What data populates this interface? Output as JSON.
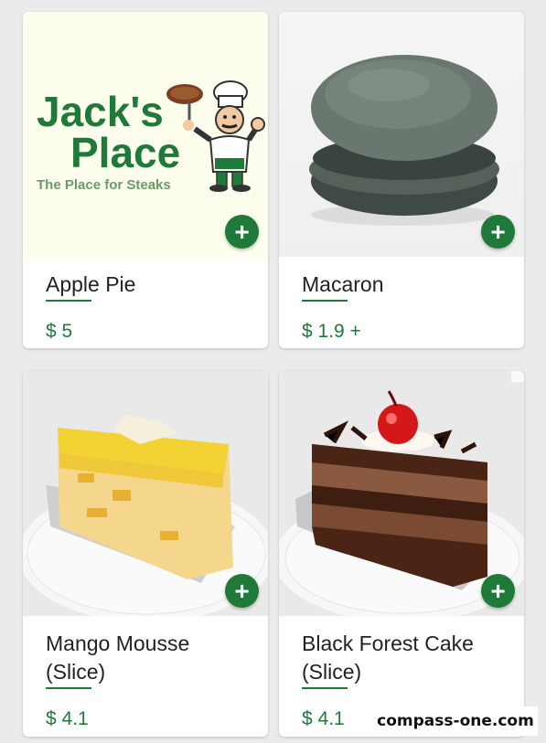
{
  "products": [
    {
      "name_line1": "Apple Pie",
      "name_line2": "",
      "price": "$ 5",
      "add_icon": "plus-icon",
      "image": "jacks-place-logo",
      "logo": {
        "line1": "Jack's",
        "line2": "Place",
        "tagline": "The Place for Steaks"
      }
    },
    {
      "name_line1": "Macaron",
      "name_line2": "",
      "price": "$ 1.9 +",
      "add_icon": "plus-icon",
      "image": "macaron-photo"
    },
    {
      "name_line1": "Mango Mousse",
      "name_line2": "(Slice)",
      "price": "$ 4.1",
      "add_icon": "plus-icon",
      "image": "mango-mousse-photo"
    },
    {
      "name_line1": "Black Forest Cake",
      "name_line2": "(Slice)",
      "price": "$ 4.1",
      "add_icon": "plus-icon",
      "image": "black-forest-cake-photo"
    }
  ],
  "watermark": "compass-one.com",
  "colors": {
    "accent": "#1f7a3a",
    "background": "#ebebeb",
    "card": "#ffffff"
  }
}
